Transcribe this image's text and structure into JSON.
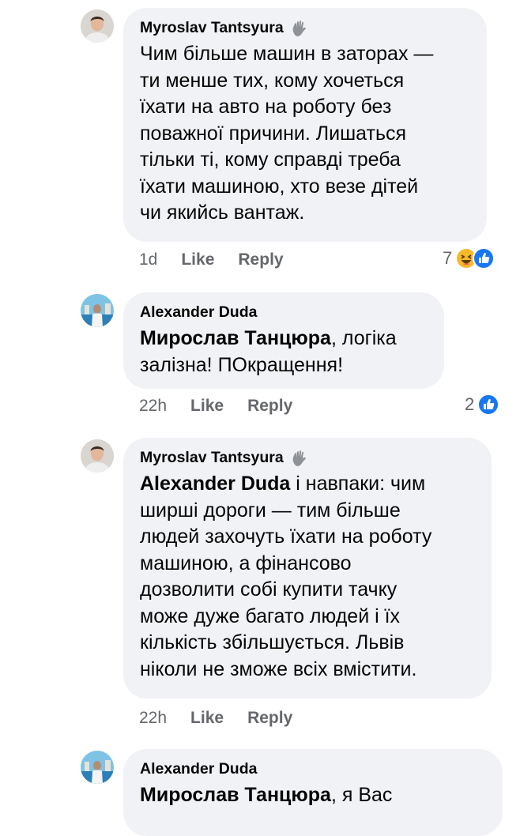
{
  "comments": [
    {
      "author": "Myroslav Tantsyura",
      "author_badge": "waving-hand-icon",
      "text_lines": [
        "Чим більше машин в заторах —",
        "ти менше тих, кому хочеться",
        "їхати на авто на роботу без",
        "поважної причини. Лишаться",
        "тільки ті, кому справді треба",
        "їхати машиною, хто везе дітей",
        "чи якийсь вантаж."
      ],
      "time": "1d",
      "like_label": "Like",
      "reply_label": "Reply",
      "reaction_count": "7",
      "reactions": [
        "haha-icon",
        "like-icon"
      ]
    },
    {
      "author": "Alexander Duda",
      "mention": "Мирослав Танцюра",
      "text_first_rest": ", логіка",
      "text_lines": [
        "залізна! ПОкращення!"
      ],
      "time": "22h",
      "like_label": "Like",
      "reply_label": "Reply",
      "reaction_count": "2",
      "reactions": [
        "like-icon"
      ]
    },
    {
      "author": "Myroslav Tantsyura",
      "author_badge": "waving-hand-icon",
      "mention": "Alexander Duda",
      "text_first_rest": " і навпаки: чим",
      "text_lines": [
        "ширші дороги — тим більше",
        "людей захочуть їхати на роботу",
        "машиною, а фінансово",
        "дозволити собі купити тачку",
        "може дуже багато людей і їх",
        "кількість збільшується. Львів",
        "ніколи не зможе всіх вмістити."
      ],
      "time": "22h",
      "like_label": "Like",
      "reply_label": "Reply"
    },
    {
      "author": "Alexander Duda",
      "mention": "Мирослав Танцюра",
      "text_first_rest": ", я Вас"
    }
  ],
  "colors": {
    "bubble": "#f0f2f5",
    "meta_text": "#65676b",
    "like_blue": "#1877f2",
    "haha_yellow": "#f7b928"
  }
}
